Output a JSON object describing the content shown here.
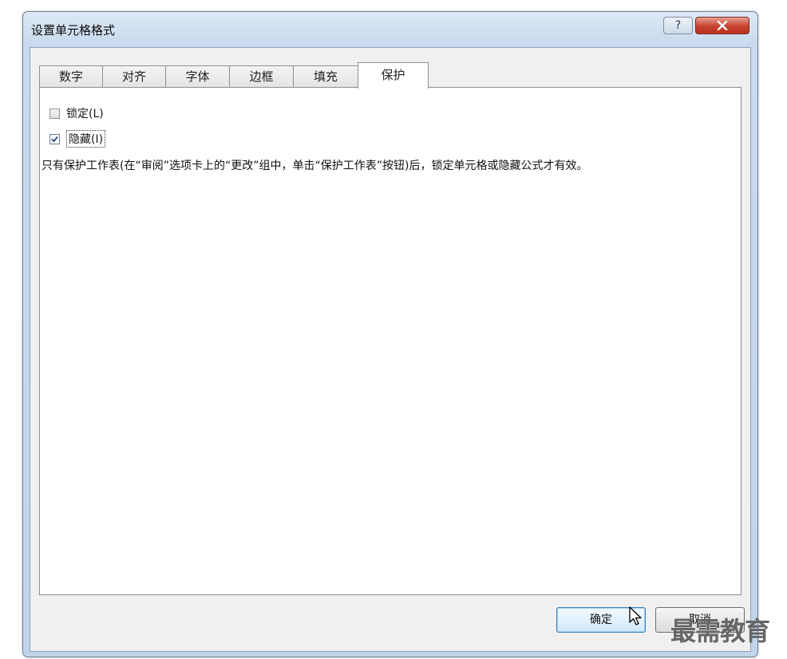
{
  "window": {
    "title": "设置单元格格式",
    "help_label": "?",
    "close_label": "X"
  },
  "tabs": [
    {
      "label": "数字"
    },
    {
      "label": "对齐"
    },
    {
      "label": "字体"
    },
    {
      "label": "边框"
    },
    {
      "label": "填充"
    },
    {
      "label": "保护"
    }
  ],
  "active_tab": "保护",
  "protection": {
    "locked": {
      "label": "锁定(L)",
      "checked": false
    },
    "hidden": {
      "label": "隐藏(I)",
      "checked": true
    },
    "note": "只有保护工作表(在“审阅”选项卡上的“更改”组中，单击“保护工作表”按钮)后，锁定单元格或隐藏公式才有效。"
  },
  "buttons": {
    "ok": "确定",
    "cancel": "取消"
  },
  "watermark": "最需教育"
}
